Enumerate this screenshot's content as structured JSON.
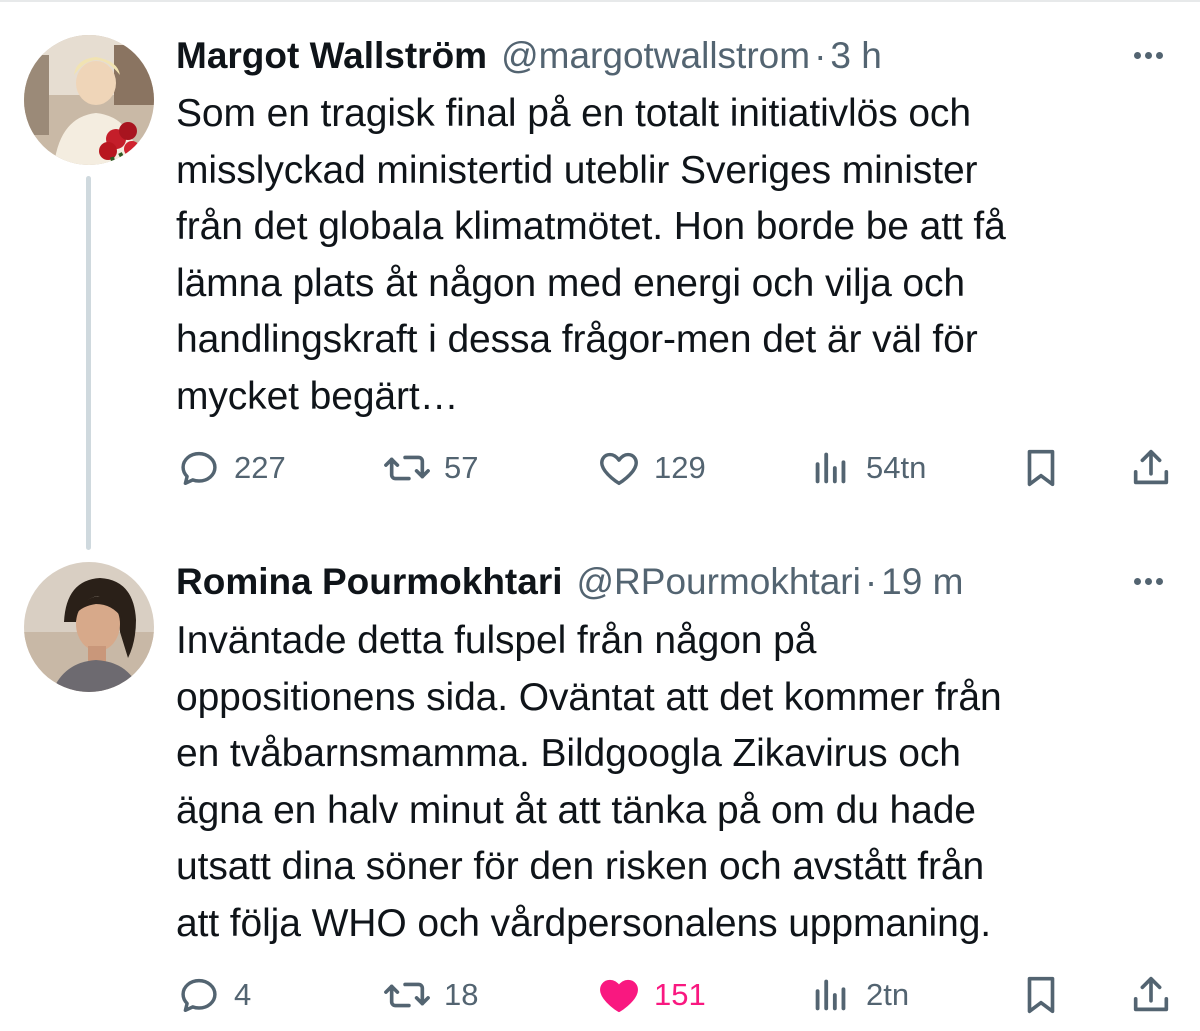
{
  "tweets": [
    {
      "author_name": "Margot Wallström",
      "handle": "@margotwallstrom",
      "separator": "·",
      "time": "3 h",
      "text_lines": [
        "Som en tragisk final på en totalt initiativlös och",
        "misslyckad ministertid uteblir Sveriges minister",
        "från det globala klimatmötet. Hon borde be att få",
        "lämna plats åt någon med energi och vilja och",
        "handlingskraft i dessa frågor-men det är väl för",
        "mycket begärt…"
      ],
      "replies": "227",
      "retweets": "57",
      "likes": "129",
      "liked": false,
      "views": "54tn"
    },
    {
      "author_name": "Romina Pourmokhtari",
      "handle": "@RPourmokhtari",
      "separator": "·",
      "time": "19 m",
      "text_lines": [
        "Inväntade detta fulspel från någon på",
        "oppositionens sida. Oväntat att det kommer från",
        "en tvåbarnsmamma. Bildgoogla Zikavirus och",
        "ägna en halv minut åt att tänka på om du hade",
        "utsatt dina söner för den risken och avstått från",
        "att följa WHO och vårdpersonalens uppmaning."
      ],
      "replies": "4",
      "retweets": "18",
      "likes": "151",
      "liked": true,
      "views": "2tn"
    }
  ],
  "icons": {
    "reply": "reply-icon",
    "retweet": "retweet-icon",
    "like": "heart-icon",
    "views": "views-icon",
    "bookmark": "bookmark-icon",
    "share": "share-icon",
    "more": "more-icon"
  },
  "colors": {
    "text": "#0f1419",
    "secondary": "#536471",
    "like_active": "#f91880",
    "thread_line": "#cfd9de"
  }
}
